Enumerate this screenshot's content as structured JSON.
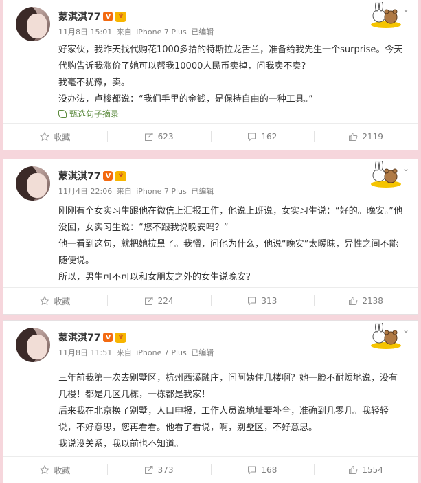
{
  "colors": {
    "background": "#f6d6dc",
    "card": "#ffffff",
    "meta": "#808080",
    "copy_link": "#5b8a3c",
    "v_badge": "#f36a11"
  },
  "posts": [
    {
      "username": "蒙淇淇77",
      "time": "11月8日 15:01",
      "source_prefix": "来自",
      "device": "iPhone 7 Plus",
      "edited": "已编辑",
      "paragraphs": [
        "好家伙，我昨天找代购花1000多拾的特斯拉龙舌兰，准备给我先生一个surprise。今天代购告诉我涨价了她可以帮我10000人民币卖掉，问我卖不卖？",
        "我毫不犹豫，卖。",
        "没办法，卢梭都说：“我们手里的金钱，是保持自由的一种工具。”"
      ],
      "copy_label": "甄选句子摘录",
      "actions": {
        "favorite": "收藏",
        "repost": "623",
        "comment": "162",
        "like": "2119"
      }
    },
    {
      "username": "蒙淇淇77",
      "time": "11月4日 22:06",
      "source_prefix": "来自",
      "device": "iPhone 7 Plus",
      "edited": "已编辑",
      "paragraphs": [
        "刚刚有个女实习生跟他在微信上汇报工作，他说上班说，女实习生说：“好的。晚安。”他没回，女实习生说：“您不跟我说晚安吗？”",
        "他一看到这句，就把她拉黑了。我懵，问他为什么，他说“晚安”太暧昧，异性之间不能随便说。",
        "所以，男生可不可以和女朋友之外的女生说晚安？"
      ],
      "actions": {
        "favorite": "收藏",
        "repost": "224",
        "comment": "313",
        "like": "2138"
      }
    },
    {
      "username": "蒙淇淇77",
      "time": "11月8日 11:51",
      "source_prefix": "来自",
      "device": "iPhone 7 Plus",
      "edited": "已编辑",
      "paragraphs": [
        "三年前我第一次去别墅区，杭州西溪融庄，问阿姨住几楼啊？她一脸不耐烦地说，没有几楼！都是几区几栋，一栋都是我家！",
        "后来我在北京换了别墅，人口申报，工作人员说地址要补全，准确到几零几。我轻轻说，不好意思，您再看看。他看了看说，啊，别墅区，不好意思。",
        "我说没关系，我以前也不知道。"
      ],
      "actions": {
        "favorite": "收藏",
        "repost": "373",
        "comment": "168",
        "like": "1554"
      }
    }
  ]
}
